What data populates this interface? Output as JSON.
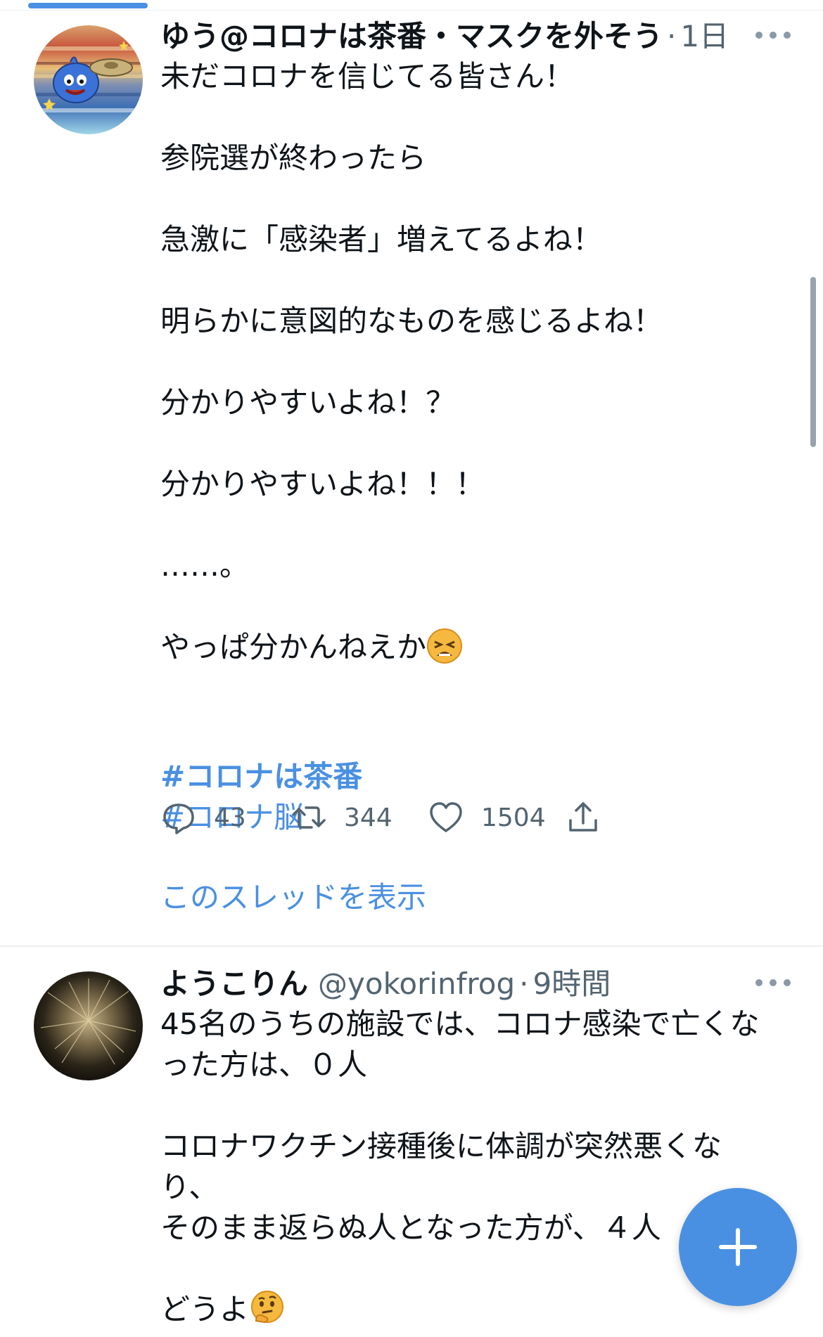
{
  "tweets": [
    {
      "author_name": "ゆう@コロナは茶番・マスクを外そう",
      "timestamp": "1日",
      "lines": [
        "未だコロナを信じてる皆さん！",
        "",
        "参院選が終わったら",
        "",
        "急激に「感染者」増えてるよね！",
        "",
        "明らかに意図的なものを感じるよね！",
        "",
        "分かりやすいよね！？",
        "",
        "分かりやすいよね！！！",
        "",
        "……。",
        "",
        "やっぱ分かんねえか"
      ],
      "last_line_emoji": "weary-face-emoji",
      "hashtags": [
        "#コロナは茶番",
        "#コロナ脳"
      ],
      "actions": {
        "replies": "43",
        "retweets": "344",
        "likes": "1504"
      },
      "thread_link": "このスレッドを表示"
    },
    {
      "author_name": "ようこりん",
      "handle": "@yokorinfrog",
      "timestamp": "9時間",
      "lines": [
        "45名のうちの施設では、コロナ感染で亡くな",
        "った方は、０人",
        "",
        "コロナワクチン接種後に体調が突然悪くなり、",
        "そのまま返らぬ人となった方が、４人",
        "",
        "どうよ"
      ],
      "last_line_emoji": "thinking-face-emoji"
    }
  ],
  "separator": "·",
  "colors": {
    "accent": "#4a90e2",
    "text": "#0f1419",
    "muted": "#536471"
  },
  "icons": {
    "reply": "reply-icon",
    "retweet": "retweet-icon",
    "like": "like-icon",
    "share": "share-icon",
    "compose": "compose-plus-icon",
    "more": "more-options-icon"
  }
}
